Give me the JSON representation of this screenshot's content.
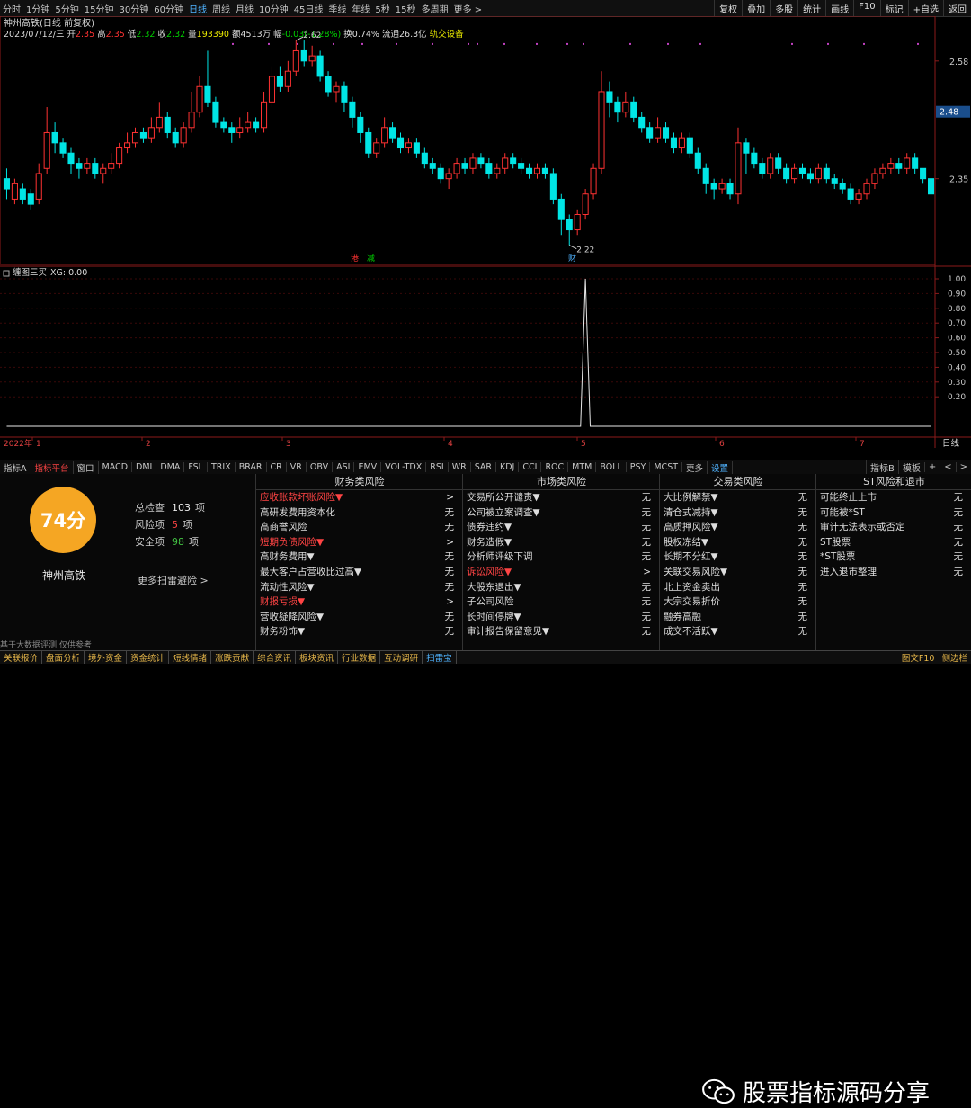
{
  "topbar": {
    "periods": [
      "分时",
      "1分钟",
      "5分钟",
      "15分钟",
      "30分钟",
      "60分钟",
      "日线",
      "周线",
      "月线",
      "10分钟",
      "45日线",
      "季线",
      "年线",
      "5秒",
      "15秒",
      "多周期",
      "更多 >"
    ],
    "active_period": "日线",
    "right_buttons": [
      "复权",
      "叠加",
      "多股",
      "统计",
      "画线",
      "F10",
      "标记",
      "+自选",
      "返回"
    ]
  },
  "main_chart": {
    "title": "神州高铁(日线 前复权)",
    "info_date": "2023/07/12/三",
    "info_open_label": "开",
    "info_open": "2.35",
    "info_high_label": "高",
    "info_high": "2.35",
    "info_low_label": "低",
    "info_low": "2.32",
    "info_close_label": "收",
    "info_close": "2.32",
    "info_vol_label": "量",
    "info_vol": "193390",
    "info_amount_label": "额",
    "info_amount": "4513万",
    "info_change_label": "幅",
    "info_change": "-0.03(-1.28%)",
    "info_turnover_label": "换",
    "info_turnover": "0.74%",
    "info_float_label": "流通",
    "info_float": "26.3亿",
    "info_sector": "轨交设备",
    "y_ticks": [
      "2.58",
      "2.35"
    ],
    "current_price": "2.48",
    "high_marker": "2.62",
    "low_marker": "2.22",
    "event_tags": [
      "港",
      "减",
      "财"
    ]
  },
  "indicator": {
    "name": "缠图三买",
    "value_label": "XG: 0.00",
    "y_ticks": [
      "1.00",
      "0.90",
      "0.80",
      "0.70",
      "0.60",
      "0.50",
      "0.40",
      "0.30",
      "0.20"
    ],
    "x_labels": [
      "2022年",
      "1",
      "2",
      "3",
      "4",
      "5",
      "6",
      "7"
    ],
    "period_label": "日线"
  },
  "chart_data": {
    "type": "candlestick",
    "title": "神州高铁(日线 前复权)",
    "ylim": [
      2.2,
      2.65
    ],
    "candles": [
      {
        "o": 2.35,
        "c": 2.33,
        "h": 2.37,
        "l": 2.31
      },
      {
        "o": 2.31,
        "c": 2.34,
        "h": 2.35,
        "l": 2.3
      },
      {
        "o": 2.33,
        "c": 2.31,
        "h": 2.34,
        "l": 2.3
      },
      {
        "o": 2.32,
        "c": 2.3,
        "h": 2.33,
        "l": 2.29
      },
      {
        "o": 2.31,
        "c": 2.36,
        "h": 2.38,
        "l": 2.3
      },
      {
        "o": 2.37,
        "c": 2.44,
        "h": 2.49,
        "l": 2.36
      },
      {
        "o": 2.44,
        "c": 2.42,
        "h": 2.46,
        "l": 2.4
      },
      {
        "o": 2.42,
        "c": 2.4,
        "h": 2.43,
        "l": 2.39
      },
      {
        "o": 2.4,
        "c": 2.38,
        "h": 2.41,
        "l": 2.36
      },
      {
        "o": 2.38,
        "c": 2.37,
        "h": 2.39,
        "l": 2.35
      },
      {
        "o": 2.37,
        "c": 2.38,
        "h": 2.39,
        "l": 2.36
      },
      {
        "o": 2.38,
        "c": 2.36,
        "h": 2.39,
        "l": 2.35
      },
      {
        "o": 2.36,
        "c": 2.37,
        "h": 2.38,
        "l": 2.34
      },
      {
        "o": 2.37,
        "c": 2.38,
        "h": 2.4,
        "l": 2.36
      },
      {
        "o": 2.38,
        "c": 2.41,
        "h": 2.42,
        "l": 2.37
      },
      {
        "o": 2.41,
        "c": 2.42,
        "h": 2.44,
        "l": 2.4
      },
      {
        "o": 2.42,
        "c": 2.44,
        "h": 2.45,
        "l": 2.41
      },
      {
        "o": 2.44,
        "c": 2.43,
        "h": 2.45,
        "l": 2.42
      },
      {
        "o": 2.43,
        "c": 2.45,
        "h": 2.47,
        "l": 2.42
      },
      {
        "o": 2.45,
        "c": 2.47,
        "h": 2.5,
        "l": 2.44
      },
      {
        "o": 2.47,
        "c": 2.44,
        "h": 2.48,
        "l": 2.43
      },
      {
        "o": 2.44,
        "c": 2.42,
        "h": 2.45,
        "l": 2.41
      },
      {
        "o": 2.42,
        "c": 2.45,
        "h": 2.46,
        "l": 2.41
      },
      {
        "o": 2.45,
        "c": 2.48,
        "h": 2.52,
        "l": 2.44
      },
      {
        "o": 2.48,
        "c": 2.53,
        "h": 2.55,
        "l": 2.47
      },
      {
        "o": 2.53,
        "c": 2.5,
        "h": 2.6,
        "l": 2.49
      },
      {
        "o": 2.5,
        "c": 2.46,
        "h": 2.51,
        "l": 2.45
      },
      {
        "o": 2.46,
        "c": 2.45,
        "h": 2.47,
        "l": 2.44
      },
      {
        "o": 2.45,
        "c": 2.44,
        "h": 2.46,
        "l": 2.42
      },
      {
        "o": 2.44,
        "c": 2.45,
        "h": 2.47,
        "l": 2.43
      },
      {
        "o": 2.45,
        "c": 2.46,
        "h": 2.48,
        "l": 2.44
      },
      {
        "o": 2.46,
        "c": 2.45,
        "h": 2.47,
        "l": 2.44
      },
      {
        "o": 2.45,
        "c": 2.5,
        "h": 2.52,
        "l": 2.44
      },
      {
        "o": 2.5,
        "c": 2.55,
        "h": 2.57,
        "l": 2.49
      },
      {
        "o": 2.55,
        "c": 2.53,
        "h": 2.57,
        "l": 2.52
      },
      {
        "o": 2.53,
        "c": 2.56,
        "h": 2.58,
        "l": 2.52
      },
      {
        "o": 2.56,
        "c": 2.6,
        "h": 2.62,
        "l": 2.55
      },
      {
        "o": 2.6,
        "c": 2.58,
        "h": 2.62,
        "l": 2.57
      },
      {
        "o": 2.58,
        "c": 2.59,
        "h": 2.61,
        "l": 2.57
      },
      {
        "o": 2.59,
        "c": 2.55,
        "h": 2.6,
        "l": 2.54
      },
      {
        "o": 2.55,
        "c": 2.52,
        "h": 2.56,
        "l": 2.51
      },
      {
        "o": 2.52,
        "c": 2.53,
        "h": 2.54,
        "l": 2.5
      },
      {
        "o": 2.53,
        "c": 2.5,
        "h": 2.54,
        "l": 2.48
      },
      {
        "o": 2.5,
        "c": 2.47,
        "h": 2.51,
        "l": 2.45
      },
      {
        "o": 2.47,
        "c": 2.44,
        "h": 2.48,
        "l": 2.42
      },
      {
        "o": 2.44,
        "c": 2.4,
        "h": 2.45,
        "l": 2.39
      },
      {
        "o": 2.4,
        "c": 2.42,
        "h": 2.43,
        "l": 2.39
      },
      {
        "o": 2.42,
        "c": 2.45,
        "h": 2.47,
        "l": 2.41
      },
      {
        "o": 2.45,
        "c": 2.43,
        "h": 2.46,
        "l": 2.42
      },
      {
        "o": 2.43,
        "c": 2.41,
        "h": 2.44,
        "l": 2.4
      },
      {
        "o": 2.41,
        "c": 2.42,
        "h": 2.43,
        "l": 2.4
      },
      {
        "o": 2.42,
        "c": 2.4,
        "h": 2.43,
        "l": 2.39
      },
      {
        "o": 2.4,
        "c": 2.38,
        "h": 2.41,
        "l": 2.37
      },
      {
        "o": 2.38,
        "c": 2.37,
        "h": 2.39,
        "l": 2.36
      },
      {
        "o": 2.37,
        "c": 2.35,
        "h": 2.38,
        "l": 2.34
      },
      {
        "o": 2.35,
        "c": 2.36,
        "h": 2.37,
        "l": 2.33
      },
      {
        "o": 2.36,
        "c": 2.38,
        "h": 2.39,
        "l": 2.35
      },
      {
        "o": 2.38,
        "c": 2.37,
        "h": 2.39,
        "l": 2.36
      },
      {
        "o": 2.37,
        "c": 2.39,
        "h": 2.4,
        "l": 2.36
      },
      {
        "o": 2.39,
        "c": 2.38,
        "h": 2.4,
        "l": 2.37
      },
      {
        "o": 2.38,
        "c": 2.36,
        "h": 2.39,
        "l": 2.35
      },
      {
        "o": 2.36,
        "c": 2.37,
        "h": 2.38,
        "l": 2.35
      },
      {
        "o": 2.37,
        "c": 2.39,
        "h": 2.4,
        "l": 2.36
      },
      {
        "o": 2.39,
        "c": 2.38,
        "h": 2.4,
        "l": 2.37
      },
      {
        "o": 2.38,
        "c": 2.37,
        "h": 2.39,
        "l": 2.36
      },
      {
        "o": 2.37,
        "c": 2.36,
        "h": 2.38,
        "l": 2.35
      },
      {
        "o": 2.36,
        "c": 2.37,
        "h": 2.38,
        "l": 2.35
      },
      {
        "o": 2.37,
        "c": 2.36,
        "h": 2.38,
        "l": 2.35
      },
      {
        "o": 2.36,
        "c": 2.31,
        "h": 2.37,
        "l": 2.3
      },
      {
        "o": 2.31,
        "c": 2.27,
        "h": 2.32,
        "l": 2.24
      },
      {
        "o": 2.27,
        "c": 2.25,
        "h": 2.28,
        "l": 2.22
      },
      {
        "o": 2.25,
        "c": 2.28,
        "h": 2.29,
        "l": 2.24
      },
      {
        "o": 2.28,
        "c": 2.32,
        "h": 2.33,
        "l": 2.27
      },
      {
        "o": 2.32,
        "c": 2.37,
        "h": 2.38,
        "l": 2.31
      },
      {
        "o": 2.37,
        "c": 2.52,
        "h": 2.56,
        "l": 2.36
      },
      {
        "o": 2.52,
        "c": 2.5,
        "h": 2.54,
        "l": 2.47
      },
      {
        "o": 2.5,
        "c": 2.48,
        "h": 2.51,
        "l": 2.46
      },
      {
        "o": 2.48,
        "c": 2.5,
        "h": 2.52,
        "l": 2.47
      },
      {
        "o": 2.5,
        "c": 2.47,
        "h": 2.51,
        "l": 2.46
      },
      {
        "o": 2.47,
        "c": 2.45,
        "h": 2.48,
        "l": 2.44
      },
      {
        "o": 2.45,
        "c": 2.43,
        "h": 2.46,
        "l": 2.42
      },
      {
        "o": 2.43,
        "c": 2.45,
        "h": 2.47,
        "l": 2.42
      },
      {
        "o": 2.45,
        "c": 2.43,
        "h": 2.46,
        "l": 2.42
      },
      {
        "o": 2.43,
        "c": 2.41,
        "h": 2.44,
        "l": 2.4
      },
      {
        "o": 2.41,
        "c": 2.43,
        "h": 2.44,
        "l": 2.4
      },
      {
        "o": 2.43,
        "c": 2.4,
        "h": 2.44,
        "l": 2.39
      },
      {
        "o": 2.4,
        "c": 2.37,
        "h": 2.41,
        "l": 2.36
      },
      {
        "o": 2.37,
        "c": 2.34,
        "h": 2.38,
        "l": 2.32
      },
      {
        "o": 2.34,
        "c": 2.33,
        "h": 2.35,
        "l": 2.31
      },
      {
        "o": 2.33,
        "c": 2.34,
        "h": 2.35,
        "l": 2.32
      },
      {
        "o": 2.34,
        "c": 2.32,
        "h": 2.35,
        "l": 2.31
      },
      {
        "o": 2.32,
        "c": 2.42,
        "h": 2.45,
        "l": 2.3
      },
      {
        "o": 2.42,
        "c": 2.4,
        "h": 2.43,
        "l": 2.36
      },
      {
        "o": 2.4,
        "c": 2.38,
        "h": 2.41,
        "l": 2.37
      },
      {
        "o": 2.38,
        "c": 2.36,
        "h": 2.39,
        "l": 2.35
      },
      {
        "o": 2.36,
        "c": 2.39,
        "h": 2.4,
        "l": 2.35
      },
      {
        "o": 2.39,
        "c": 2.37,
        "h": 2.4,
        "l": 2.36
      },
      {
        "o": 2.37,
        "c": 2.35,
        "h": 2.38,
        "l": 2.34
      },
      {
        "o": 2.35,
        "c": 2.37,
        "h": 2.38,
        "l": 2.34
      },
      {
        "o": 2.37,
        "c": 2.36,
        "h": 2.38,
        "l": 2.35
      },
      {
        "o": 2.36,
        "c": 2.35,
        "h": 2.37,
        "l": 2.34
      },
      {
        "o": 2.35,
        "c": 2.37,
        "h": 2.38,
        "l": 2.34
      },
      {
        "o": 2.37,
        "c": 2.35,
        "h": 2.38,
        "l": 2.34
      },
      {
        "o": 2.35,
        "c": 2.34,
        "h": 2.36,
        "l": 2.33
      },
      {
        "o": 2.34,
        "c": 2.33,
        "h": 2.35,
        "l": 2.32
      },
      {
        "o": 2.33,
        "c": 2.31,
        "h": 2.34,
        "l": 2.3
      },
      {
        "o": 2.31,
        "c": 2.32,
        "h": 2.33,
        "l": 2.3
      },
      {
        "o": 2.32,
        "c": 2.34,
        "h": 2.35,
        "l": 2.31
      },
      {
        "o": 2.34,
        "c": 2.36,
        "h": 2.37,
        "l": 2.33
      },
      {
        "o": 2.36,
        "c": 2.37,
        "h": 2.38,
        "l": 2.35
      },
      {
        "o": 2.37,
        "c": 2.38,
        "h": 2.39,
        "l": 2.36
      },
      {
        "o": 2.38,
        "c": 2.37,
        "h": 2.39,
        "l": 2.36
      },
      {
        "o": 2.37,
        "c": 2.39,
        "h": 2.4,
        "l": 2.36
      },
      {
        "o": 2.39,
        "c": 2.37,
        "h": 2.4,
        "l": 2.36
      },
      {
        "o": 2.37,
        "c": 2.35,
        "h": 2.37,
        "l": 2.34
      },
      {
        "o": 2.35,
        "c": 2.32,
        "h": 2.35,
        "l": 2.32
      }
    ],
    "xg_signal_index": [
      72,
      116
    ]
  },
  "panel": {
    "score": "74分",
    "stock_name": "神州高铁",
    "stats": [
      {
        "label": "总检查",
        "value": "103",
        "unit": "项",
        "tone": ""
      },
      {
        "label": "风险项",
        "value": "5",
        "unit": "项",
        "tone": "red"
      },
      {
        "label": "安全项",
        "value": "98",
        "unit": "项",
        "tone": "green"
      }
    ],
    "more_scan": "更多扫雷避险 >",
    "disclaimer": "基于大数据评测,仅供参考",
    "columns": [
      {
        "head": "财务类风险",
        "items": [
          {
            "label": "应收账款坏账风险▼",
            "status": ">",
            "red": true
          },
          {
            "label": "高研发费用资本化",
            "status": "无",
            "red": false
          },
          {
            "label": "高商誉风险",
            "status": "无",
            "red": false
          },
          {
            "label": "短期负债风险▼",
            "status": ">",
            "red": true
          },
          {
            "label": "高财务费用▼",
            "status": "无",
            "red": false
          },
          {
            "label": "最大客户占营收比过高▼",
            "status": "无",
            "red": false
          },
          {
            "label": "流动性风险▼",
            "status": "无",
            "red": false
          },
          {
            "label": "财报亏损▼",
            "status": ">",
            "red": true
          },
          {
            "label": "营收疑降风险▼",
            "status": "无",
            "red": false
          },
          {
            "label": "财务粉饰▼",
            "status": "无",
            "red": false
          }
        ]
      },
      {
        "head": "市场类风险",
        "items": [
          {
            "label": "交易所公开谴责▼",
            "status": "无",
            "red": false
          },
          {
            "label": "公司被立案调查▼",
            "status": "无",
            "red": false
          },
          {
            "label": "债券违约▼",
            "status": "无",
            "red": false
          },
          {
            "label": "财务造假▼",
            "status": "无",
            "red": false
          },
          {
            "label": "分析师评级下调",
            "status": "无",
            "red": false
          },
          {
            "label": "诉讼风险▼",
            "status": ">",
            "red": true
          },
          {
            "label": "大股东退出▼",
            "status": "无",
            "red": false
          },
          {
            "label": "子公司风险",
            "status": "无",
            "red": false
          },
          {
            "label": "长时间停牌▼",
            "status": "无",
            "red": false
          },
          {
            "label": "审计报告保留意见▼",
            "status": "无",
            "red": false
          }
        ]
      },
      {
        "head": "交易类风险",
        "items": [
          {
            "label": "大比例解禁▼",
            "status": "无",
            "red": false
          },
          {
            "label": "清仓式减持▼",
            "status": "无",
            "red": false
          },
          {
            "label": "高质押风险▼",
            "status": "无",
            "red": false
          },
          {
            "label": "股权冻结▼",
            "status": "无",
            "red": false
          },
          {
            "label": "长期不分红▼",
            "status": "无",
            "red": false
          },
          {
            "label": "关联交易风险▼",
            "status": "无",
            "red": false
          },
          {
            "label": "北上资金卖出",
            "status": "无",
            "red": false
          },
          {
            "label": "大宗交易折价",
            "status": "无",
            "red": false
          },
          {
            "label": "融券高融",
            "status": "无",
            "red": false
          },
          {
            "label": "成交不活跃▼",
            "status": "无",
            "red": false
          }
        ]
      },
      {
        "head": "ST风险和退市",
        "items": [
          {
            "label": "可能终止上市",
            "status": "无",
            "red": false
          },
          {
            "label": "可能被*ST",
            "status": "无",
            "red": false
          },
          {
            "label": "审计无法表示或否定",
            "status": "无",
            "red": false
          },
          {
            "label": "ST股票",
            "status": "无",
            "red": false
          },
          {
            "label": "*ST股票",
            "status": "无",
            "red": false
          },
          {
            "label": "进入退市整理",
            "status": "无",
            "red": false
          }
        ]
      }
    ]
  },
  "tabbar": {
    "tabs": [
      "指标A",
      "指标平台",
      "窗口",
      "MACD",
      "DMI",
      "DMA",
      "FSL",
      "TRIX",
      "BRAR",
      "CR",
      "VR",
      "OBV",
      "ASI",
      "EMV",
      "VOL-TDX",
      "RSI",
      "WR",
      "SAR",
      "KDJ",
      "CCI",
      "ROC",
      "MTM",
      "BOLL",
      "PSY",
      "MCST",
      "更多",
      "设置"
    ],
    "right_tabs": [
      "指标B",
      "模板",
      "+",
      "<",
      ">"
    ]
  },
  "bottombar": {
    "items": [
      "关联报价",
      "盘面分析",
      "境外资金",
      "资金统计",
      "短线情绪",
      "涨跌贡献",
      "综合资讯",
      "板块资讯",
      "行业数据",
      "互动调研",
      "扫雷宝"
    ],
    "active": "扫雷宝",
    "right": [
      "图文F10",
      "侧边栏"
    ]
  },
  "watermark": {
    "text": "股票指标源码分享"
  },
  "colors": {
    "up": "#ff3232",
    "down": "#00e5e5",
    "accent": "#4fb3ff",
    "orange": "#f5a623"
  }
}
